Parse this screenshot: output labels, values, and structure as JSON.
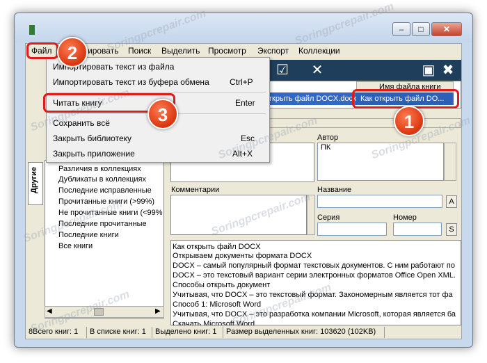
{
  "menu": {
    "items": [
      "Файл",
      "Модифицировать",
      "Поиск",
      "Выделить",
      "Просмотр",
      "Экспорт",
      "Коллекции"
    ]
  },
  "menu_visible": {
    "file": "Файл",
    "modify_tail": "ировать",
    "search": "Поиск",
    "select": "Выделить",
    "view": "Просмотр",
    "export": "Экспорт",
    "collections": "Коллекции"
  },
  "dropdown": {
    "items": [
      {
        "label": "Импортировать текст из файла",
        "shortcut": ""
      },
      {
        "label": "Импортировать текст из буфера обмена",
        "shortcut": "Ctrl+P"
      },
      {
        "label": "Читать книгу",
        "shortcut": "Enter"
      },
      {
        "label": "Сохранить всё",
        "shortcut": ""
      },
      {
        "label": "Закрыть библиотеку",
        "shortcut": "Esc"
      },
      {
        "label": "Закрыть приложение",
        "shortcut": "Alt+X"
      }
    ]
  },
  "book_list": {
    "column_header": "Имя файла книги",
    "selected_title": "ткрыть файл DOCX.docx",
    "selected_filename": "Как открыть файл DO..."
  },
  "sidebar": {
    "tab_label": "Другие",
    "tree": [
      "Различия в коллекциях",
      "Дубликаты в коллекциях",
      "Последние исправленные",
      "Прочитанные книги (>99%)",
      "Не прочитанные книги (<99%",
      "Последние прочитанные",
      "Последние книги",
      "Все книги"
    ]
  },
  "details": {
    "author_label": "Автор",
    "author_value": "ПК",
    "comments_label": "Комментарии",
    "title_label": "Название",
    "series_label": "Серия",
    "number_label": "Номер",
    "btn_a": "A",
    "btn_s": "S"
  },
  "description": [
    "Как открыть файл DOCX",
    "Открываем документы формата DOCX",
    "DOCX – самый популярный формат текстовых документов. С ним работают по",
    "DOCX – это текстовый вариант серии электронных форматов Office Open XML.",
    "Способы открыть документ",
    "Учитывая, что DOCX – это текстовый формат. Закономерным является тот фа",
    "Способ 1: Microsoft Word",
    "Учитывая, что DOCX – это разработка компании Microsoft, которая является ба",
    "Скачать Microsoft Word"
  ],
  "status": {
    "total": "8Всего книг: 1",
    "in_list": "В списке книг: 1",
    "selected": "Выделено книг: 1",
    "size": "Размер выделенных книг: 103620  (102KB)"
  },
  "badges": [
    "1",
    "2",
    "3"
  ],
  "watermark": "Soringpcrepair.com",
  "colors": {
    "callout_red": "#e11a1a",
    "selection_blue": "#3168c4",
    "toolbar_dark": "#1f3e5c"
  }
}
